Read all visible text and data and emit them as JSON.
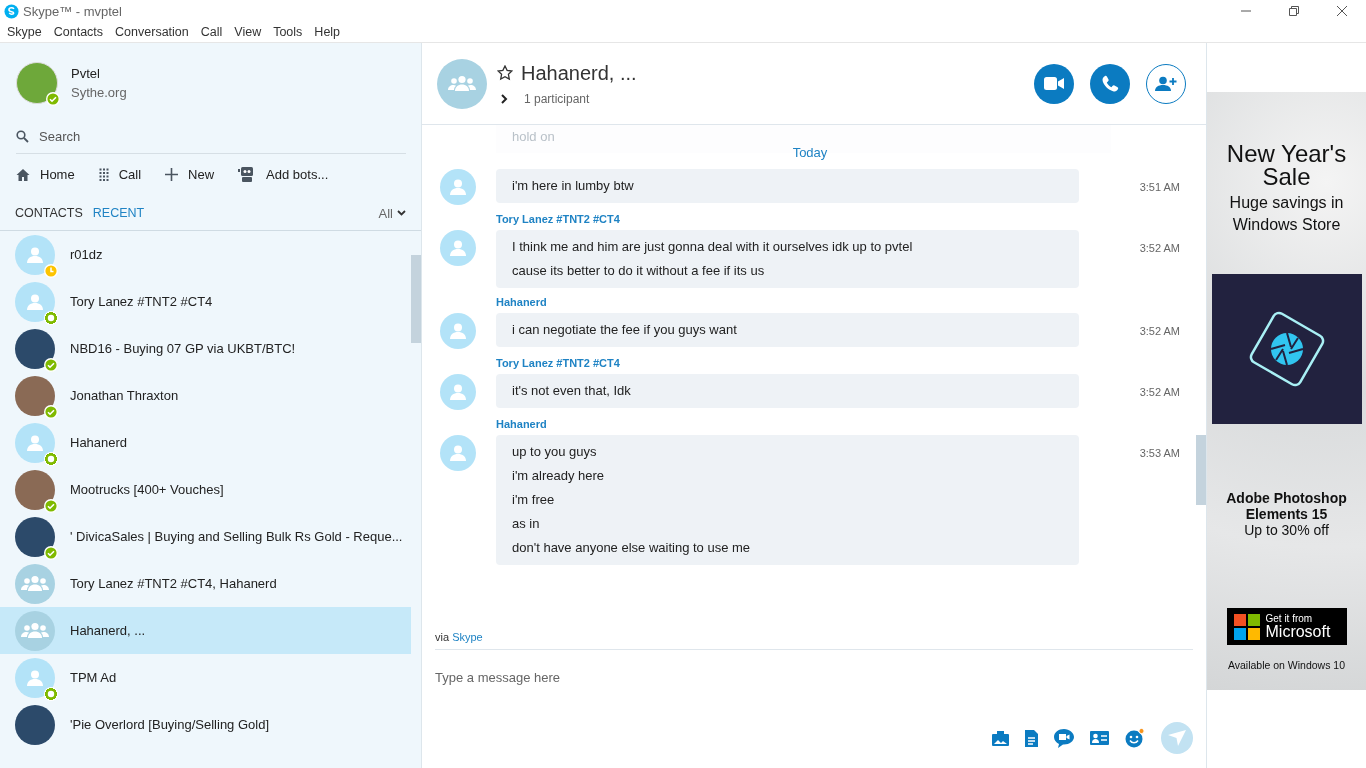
{
  "window": {
    "title": "Skype™ - mvptel"
  },
  "menu": [
    "Skype",
    "Contacts",
    "Conversation",
    "Call",
    "View",
    "Tools",
    "Help"
  ],
  "profile": {
    "name": "Pvtel",
    "mood": "Sythe.org",
    "presence": {
      "kind": "check",
      "color": "#7fba00"
    }
  },
  "search": {
    "placeholder": "Search"
  },
  "nav": [
    {
      "kind": "home",
      "label": "Home"
    },
    {
      "kind": "dialpad",
      "label": "Call"
    },
    {
      "kind": "plus",
      "label": "New"
    },
    {
      "kind": "bot",
      "label": "Add bots..."
    }
  ],
  "tabs": [
    {
      "label": "CONTACTS",
      "selected": false
    },
    {
      "label": "RECENT",
      "selected": true
    }
  ],
  "filter": "All",
  "contacts": [
    {
      "name": "r01dz",
      "kind": "person",
      "presence": {
        "kind": "away",
        "color": "#fdc400"
      },
      "selected": false
    },
    {
      "name": "Tory Lanez #TNT2 #CT4",
      "kind": "person",
      "presence": {
        "kind": "ring",
        "color": "#7fba00"
      },
      "selected": false
    },
    {
      "name": "NBD16 - Buying 07 GP via UKBT/BTC!",
      "kind": "logo",
      "presence": {
        "kind": "check",
        "color": "#7fba00"
      },
      "selected": false
    },
    {
      "name": "Jonathan Thraxton",
      "kind": "photo",
      "presence": {
        "kind": "check",
        "color": "#7fba00"
      },
      "selected": false
    },
    {
      "name": "Hahanerd",
      "kind": "person",
      "presence": {
        "kind": "ring",
        "color": "#7fba00"
      },
      "selected": false
    },
    {
      "name": "Mootrucks [400+ Vouches]",
      "kind": "photo",
      "presence": {
        "kind": "check",
        "color": "#7fba00"
      },
      "selected": false
    },
    {
      "name": "' DivicaSales | Buying and Selling Bulk Rs Gold - Reque...",
      "kind": "logo",
      "presence": {
        "kind": "check",
        "color": "#7fba00"
      },
      "selected": false
    },
    {
      "name": "Tory Lanez #TNT2 #CT4, Hahanerd",
      "kind": "group",
      "selected": false
    },
    {
      "name": "Hahanerd, ...",
      "kind": "group",
      "selected": true
    },
    {
      "name": "TPM Ad",
      "kind": "person",
      "presence": {
        "kind": "ring",
        "color": "#7fba00"
      },
      "selected": false
    },
    {
      "name": "'Pie Overlord [Buying/Selling Gold]",
      "kind": "logo",
      "selected": false
    }
  ],
  "conversation": {
    "title": "Hahanerd, ...",
    "favorite": false,
    "participants": "1 participant"
  },
  "faded_message": "hold on",
  "date_divider": "Today",
  "messages": [
    {
      "time": "3:51 AM",
      "lines": [
        "i'm here in lumby btw"
      ]
    },
    {
      "sender": "Tory Lanez #TNT2 #CT4",
      "time": "3:52 AM",
      "lines": [
        "I think me and him are just gonna deal with it ourselves idk up to pvtel",
        "cause its better to do it without a fee if its us"
      ]
    },
    {
      "sender": "Hahanerd",
      "time": "3:52 AM",
      "lines": [
        "i can negotiate the fee if you guys want"
      ]
    },
    {
      "sender": "Tory Lanez #TNT2 #CT4",
      "time": "3:52 AM",
      "lines": [
        "it's not even that, Idk"
      ]
    },
    {
      "sender": "Hahanerd",
      "time": "3:53 AM",
      "lines": [
        "up to you guys",
        "i'm already here",
        "i'm free",
        "as in",
        "don't have anyone else waiting to use me"
      ]
    }
  ],
  "via": {
    "prefix": "via",
    "link": "Skype"
  },
  "composer": {
    "placeholder": "Type a message here"
  },
  "ad": {
    "headline": "New Year's Sale",
    "subline": "Huge savings in Windows Store",
    "product": "Adobe Photoshop Elements 15",
    "offer": "Up to 30% off",
    "badge_small": "Get it from",
    "badge_big": "Microsoft",
    "footer": "Available on Windows 10"
  }
}
